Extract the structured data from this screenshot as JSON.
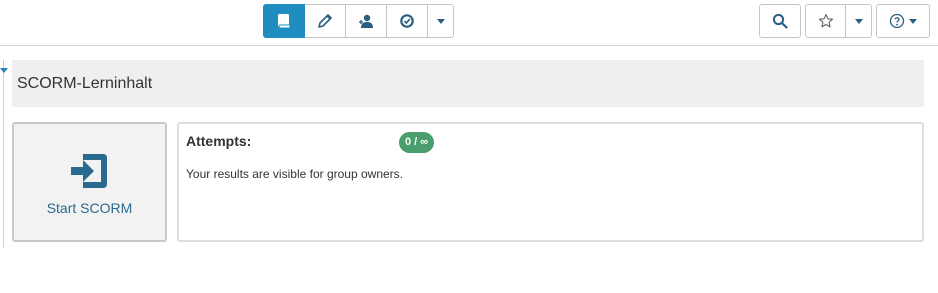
{
  "toolbar": {
    "left_group": [
      {
        "icon": "book-icon",
        "active": true
      },
      {
        "icon": "pencil-icon",
        "active": false
      },
      {
        "icon": "user-icon",
        "active": false
      },
      {
        "icon": "badge-check-icon",
        "active": false
      },
      {
        "icon": "caret-down-icon",
        "active": false
      }
    ],
    "right": {
      "search_icon": "search-icon",
      "bookmark_icon": "star-icon",
      "help_icon": "help-icon"
    }
  },
  "page": {
    "title": "SCORM-Lerninhalt"
  },
  "start_card": {
    "label": "Start SCORM",
    "icon": "sign-in-icon",
    "color": "#2a6a8f"
  },
  "info_card": {
    "attempts_label": "Attempts:",
    "attempts_value": "0 / ∞",
    "results_text": "Your results are visible for group owners.",
    "badge_color": "#4a9e6d"
  },
  "colors": {
    "accent": "#1f8dbf",
    "title_bar_bg": "#efefef"
  }
}
